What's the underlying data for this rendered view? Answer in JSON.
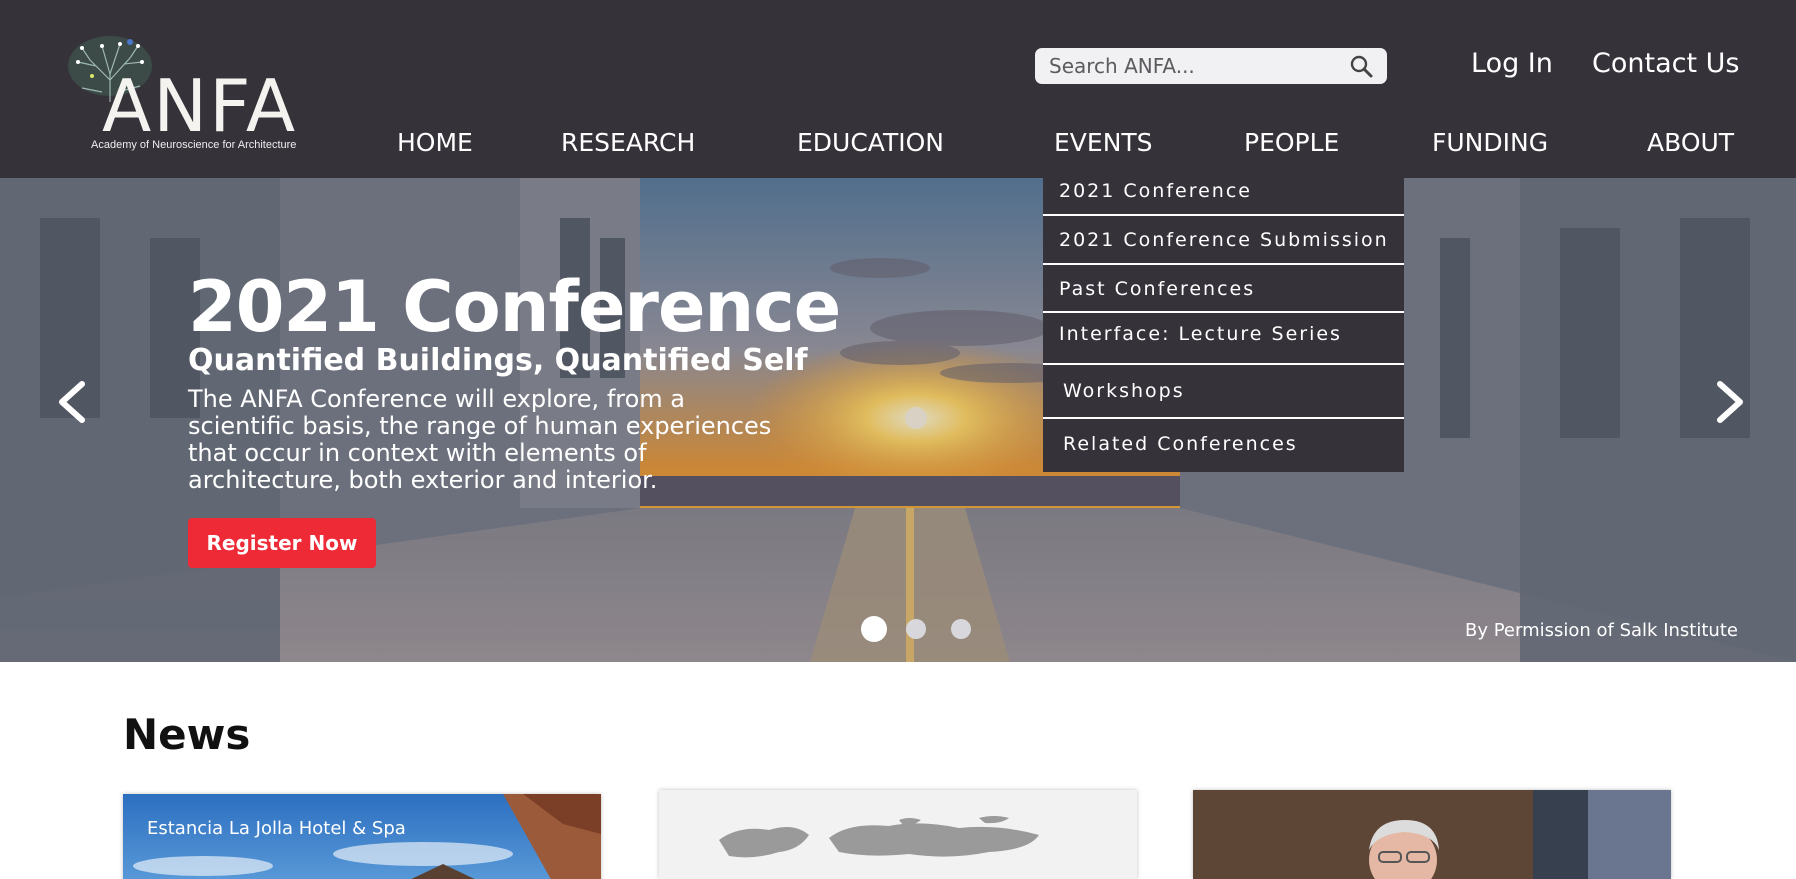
{
  "brand": {
    "name": "ANFA",
    "tagline": "Academy of Neuroscience for Architecture"
  },
  "search": {
    "placeholder": "Search ANFA..."
  },
  "top_links": {
    "login": "Log In",
    "contact": "Contact Us"
  },
  "nav": {
    "items": [
      "HOME",
      "RESEARCH",
      "EDUCATION",
      "EVENTS",
      "PEOPLE",
      "FUNDING",
      "ABOUT"
    ]
  },
  "events_dropdown": {
    "items": [
      "2021 Conference",
      "2021 Conference Submission",
      "Past Conferences",
      "Interface: Lecture Series",
      "Workshops",
      "Related Conferences"
    ]
  },
  "hero": {
    "title": "2021 Conference",
    "subtitle": "Quantified Buildings, Quantified Self",
    "description": "The ANFA Conference will explore, from a scientific basis, the range of human experiences that occur in context with elements of architecture, both exterior and interior.",
    "cta": "Register Now",
    "credit": "By Permission of Salk Institute",
    "active_slide": 1,
    "slide_count": 3
  },
  "news": {
    "heading": "News",
    "cards": [
      {
        "label": "Estancia La Jolla Hotel & Spa"
      },
      {
        "label": ""
      },
      {
        "label": ""
      }
    ]
  },
  "colors": {
    "header_bg": "#35323a",
    "cta": "#ee2a36",
    "dropdown_bg": "#35323a"
  },
  "icons": {
    "search": "search-icon",
    "prev": "chevron-left-icon",
    "next": "chevron-right-icon"
  }
}
